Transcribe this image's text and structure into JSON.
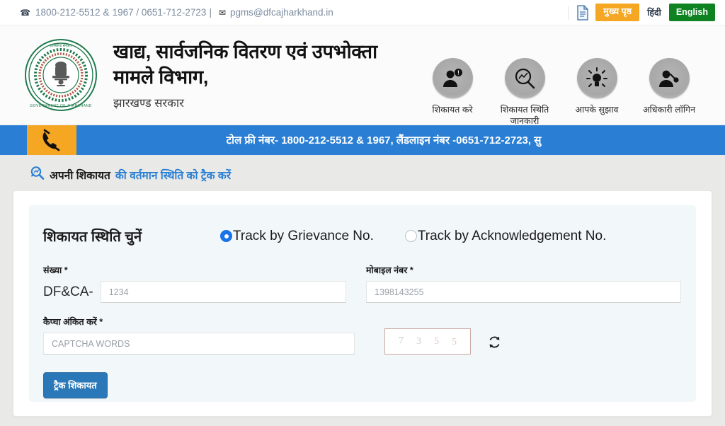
{
  "topbar": {
    "phone_icon": "phone-icon",
    "phone_primary": "1800-212-5512",
    "amp": "&",
    "phone_secondary": "1967 / 0651-712-2723",
    "pipe": "|",
    "mail_icon": "envelope-icon",
    "email": "pgms@dfcajharkhand.in",
    "doc_icon": "document-icon",
    "home_button": "मुख्य पृष्ठ",
    "lang_hindi": "हिंदी",
    "lang_english": "English"
  },
  "header": {
    "emblem_alt": "jharkhand-government-emblem",
    "emblem_top_text": "झारखण्ड सरकार",
    "emblem_bottom_text": "GOVERNMENT OF JHARKHAND",
    "department_title": "खाद्य, सार्वजनिक वितरण एवं उपभोक्ता मामले विभाग,",
    "department_sub": "झारखण्ड सरकार",
    "nav": [
      {
        "icon": "person-alert-icon",
        "label": "शिकायत करे"
      },
      {
        "icon": "magnifier-chart-icon",
        "label": "शिकायत स्थिति जानकारी"
      },
      {
        "icon": "lightbulb-icon",
        "label": "आपके सुझाव"
      },
      {
        "icon": "person-key-icon",
        "label": "अधिकारी लॉगिन"
      }
    ]
  },
  "banner": {
    "phone_icon": "phone-handset-icon",
    "text": "टोल फ्री नंबर- 1800-212-5512 & 1967, लैंडलाइन नंबर -0651-712-2723, सु"
  },
  "section": {
    "icon": "search-status-icon",
    "title_dark": "अपनी शिकायत",
    "title_blue": "की वर्तमान स्थिति को ट्रैक करें"
  },
  "form": {
    "select_label": "शिकायत स्थिति चुनें",
    "radio_options": [
      {
        "label": "Track by Grievance No.",
        "selected": true
      },
      {
        "label": "Track by Acknowledgement No.",
        "selected": false
      }
    ],
    "number_label": "संख्या *",
    "number_prefix": "DF&CA-",
    "number_placeholder": "1234",
    "number_value": "",
    "mobile_label": "मोबाइल नंबर *",
    "mobile_placeholder": "1398143255",
    "mobile_value": "",
    "captcha_label": "कैप्चा अंकित करें *",
    "captcha_placeholder": "CAPTCHA WORDS",
    "captcha_value": "",
    "captcha_digits": [
      "7",
      "3",
      "5",
      "5"
    ],
    "refresh_icon": "refresh-icon",
    "submit_label": "ट्रैक शिकायत"
  },
  "colors": {
    "banner_blue": "#2a7fd4",
    "accent_orange": "#f5a623",
    "accent_green": "#0f8221",
    "link_blue": "#2a7fd4",
    "radio_blue": "#1a73e8",
    "button_blue": "#2b78b8"
  }
}
